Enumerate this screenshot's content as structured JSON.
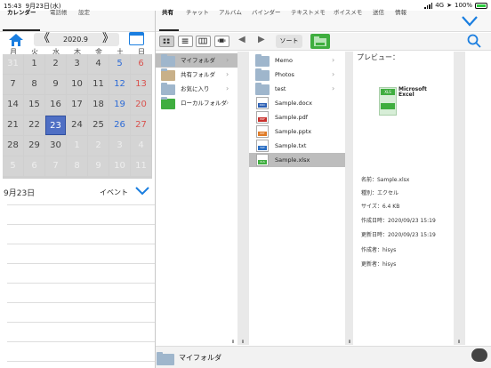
{
  "status": {
    "time": "15:43",
    "date": "9月23日(水)",
    "network": "4G",
    "battery": "100%"
  },
  "left_tabs": [
    {
      "label": "カレンダー",
      "active": true
    },
    {
      "label": "電話帳",
      "active": false
    },
    {
      "label": "設定",
      "active": false
    }
  ],
  "calendar": {
    "month": "2020.9",
    "prev": "《",
    "next": "》",
    "weekdays": [
      "月",
      "火",
      "水",
      "木",
      "金",
      "土",
      "日"
    ],
    "weeks": [
      [
        "31",
        "1",
        "2",
        "3",
        "4",
        "5",
        "6"
      ],
      [
        "7",
        "8",
        "9",
        "10",
        "11",
        "12",
        "13"
      ],
      [
        "14",
        "15",
        "16",
        "17",
        "18",
        "19",
        "20"
      ],
      [
        "21",
        "22",
        "23",
        "24",
        "25",
        "26",
        "27"
      ],
      [
        "28",
        "29",
        "30",
        "1",
        "2",
        "3",
        "4"
      ],
      [
        "5",
        "6",
        "7",
        "8",
        "9",
        "10",
        "11"
      ]
    ],
    "selected_date": "9月23日",
    "event_label": "イベント"
  },
  "right_tabs": [
    {
      "label": "共有",
      "active": true
    },
    {
      "label": "チャット",
      "active": false
    },
    {
      "label": "アルバム",
      "active": false
    },
    {
      "label": "バインダー",
      "active": false
    },
    {
      "label": "テキストメモ",
      "active": false
    },
    {
      "label": "ボイスメモ",
      "active": false
    },
    {
      "label": "送信",
      "active": false
    },
    {
      "label": "情報",
      "active": false
    }
  ],
  "toolbar": {
    "sort_label": "ソート"
  },
  "colors": {
    "accent": "#1a7ee0",
    "selected_day": "#4f6fc4",
    "excel_green": "#3fae3f"
  },
  "locations": [
    {
      "label": "マイフォルダ",
      "selected": true
    },
    {
      "label": "共有フォルダ",
      "selected": false
    },
    {
      "label": "お気に入り",
      "selected": false
    },
    {
      "label": "ローカルフォルダ",
      "selected": false
    }
  ],
  "files": [
    {
      "label": "Memo",
      "kind": "folder"
    },
    {
      "label": "Photos",
      "kind": "folder"
    },
    {
      "label": "test",
      "kind": "folder"
    },
    {
      "label": "Sample.docx",
      "kind": "docx",
      "badge": "DOC"
    },
    {
      "label": "Sample.pdf",
      "kind": "pdf",
      "badge": "PDF"
    },
    {
      "label": "Sample.pptx",
      "kind": "pptx",
      "badge": "PPT"
    },
    {
      "label": "Sample.txt",
      "kind": "txt",
      "badge": "TXT"
    },
    {
      "label": "Sample.xlsx",
      "kind": "xlsx",
      "badge": "XLS",
      "selected": true
    }
  ],
  "preview": {
    "title": "プレビュー：",
    "icon_text": "Microsoft Excel",
    "icon_badge": "XLS",
    "details": [
      "名前：Sample.xlsx",
      "種別：エクセル",
      "サイズ：6.4 KB",
      "作成日時：2020/09/23 15:19",
      "更新日時：2020/09/23 15:19",
      "作成者：hisys",
      "更新者：hisys"
    ]
  },
  "path": "マイフォルダ",
  "pane_marks": [
    "॥",
    "॥",
    "॥",
    "॥"
  ]
}
